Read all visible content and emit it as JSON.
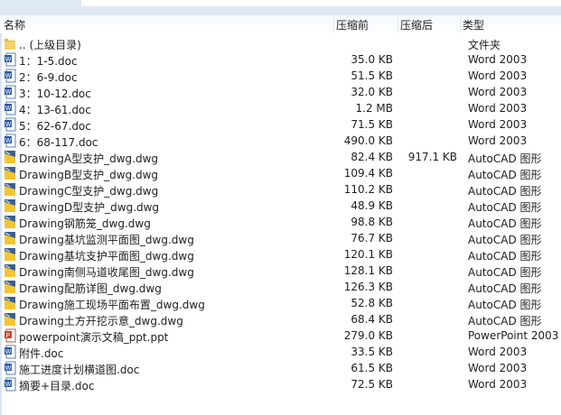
{
  "header": {
    "name": "名称",
    "size": "压缩前",
    "compressed": "压缩后",
    "type": "类型"
  },
  "files": [
    {
      "name": ".. (上级目录)",
      "size": "",
      "compressed": "",
      "type": "文件夹",
      "icon": "folder"
    },
    {
      "name": "1：1-5.doc",
      "size": "35.0 KB",
      "compressed": "",
      "type": "Word 2003",
      "icon": "word"
    },
    {
      "name": "2：6-9.doc",
      "size": "51.5 KB",
      "compressed": "",
      "type": "Word 2003",
      "icon": "word"
    },
    {
      "name": "3：10-12.doc",
      "size": "32.0 KB",
      "compressed": "",
      "type": "Word 2003",
      "icon": "word"
    },
    {
      "name": "4：13-61.doc",
      "size": "1.2 MB",
      "compressed": "",
      "type": "Word 2003",
      "icon": "word"
    },
    {
      "name": "5：62-67.doc",
      "size": "71.5 KB",
      "compressed": "",
      "type": "Word 2003",
      "icon": "word"
    },
    {
      "name": "6：68-117.doc",
      "size": "490.0 KB",
      "compressed": "",
      "type": "Word 2003",
      "icon": "word"
    },
    {
      "name": "DrawingA型支护_dwg.dwg",
      "size": "82.4 KB",
      "compressed": "917.1 KB",
      "type": "AutoCAD 图形",
      "icon": "dwg"
    },
    {
      "name": "DrawingB型支护_dwg.dwg",
      "size": "109.4 KB",
      "compressed": "",
      "type": "AutoCAD 图形",
      "icon": "dwg"
    },
    {
      "name": "DrawingC型支护_dwg.dwg",
      "size": "110.2 KB",
      "compressed": "",
      "type": "AutoCAD 图形",
      "icon": "dwg"
    },
    {
      "name": "DrawingD型支护_dwg.dwg",
      "size": "48.9 KB",
      "compressed": "",
      "type": "AutoCAD 图形",
      "icon": "dwg"
    },
    {
      "name": "Drawing钢筋笼_dwg.dwg",
      "size": "98.8 KB",
      "compressed": "",
      "type": "AutoCAD 图形",
      "icon": "dwg"
    },
    {
      "name": "Drawing基坑监测平面图_dwg.dwg",
      "size": "76.7 KB",
      "compressed": "",
      "type": "AutoCAD 图形",
      "icon": "dwg"
    },
    {
      "name": "Drawing基坑支护平面图_dwg.dwg",
      "size": "120.1 KB",
      "compressed": "",
      "type": "AutoCAD 图形",
      "icon": "dwg"
    },
    {
      "name": "Drawing南侧马道收尾图_dwg.dwg",
      "size": "128.1 KB",
      "compressed": "",
      "type": "AutoCAD 图形",
      "icon": "dwg"
    },
    {
      "name": "Drawing配筋详图_dwg.dwg",
      "size": "126.3 KB",
      "compressed": "",
      "type": "AutoCAD 图形",
      "icon": "dwg"
    },
    {
      "name": "Drawing施工现场平面布置_dwg.dwg",
      "size": "52.8 KB",
      "compressed": "",
      "type": "AutoCAD 图形",
      "icon": "dwg"
    },
    {
      "name": "Drawing土方开挖示意_dwg.dwg",
      "size": "68.4 KB",
      "compressed": "",
      "type": "AutoCAD 图形",
      "icon": "dwg"
    },
    {
      "name": "powerpoint演示文稿_ppt.ppt",
      "size": "279.0 KB",
      "compressed": "",
      "type": "PowerPoint 2003",
      "icon": "ppt"
    },
    {
      "name": "附件.doc",
      "size": "33.5 KB",
      "compressed": "",
      "type": "Word 2003",
      "icon": "word"
    },
    {
      "name": "施工进度计划横道图.doc",
      "size": "61.5 KB",
      "compressed": "",
      "type": "Word 2003",
      "icon": "word"
    },
    {
      "name": "摘要+目录.doc",
      "size": "72.5 KB",
      "compressed": "",
      "type": "Word 2003",
      "icon": "word"
    }
  ]
}
